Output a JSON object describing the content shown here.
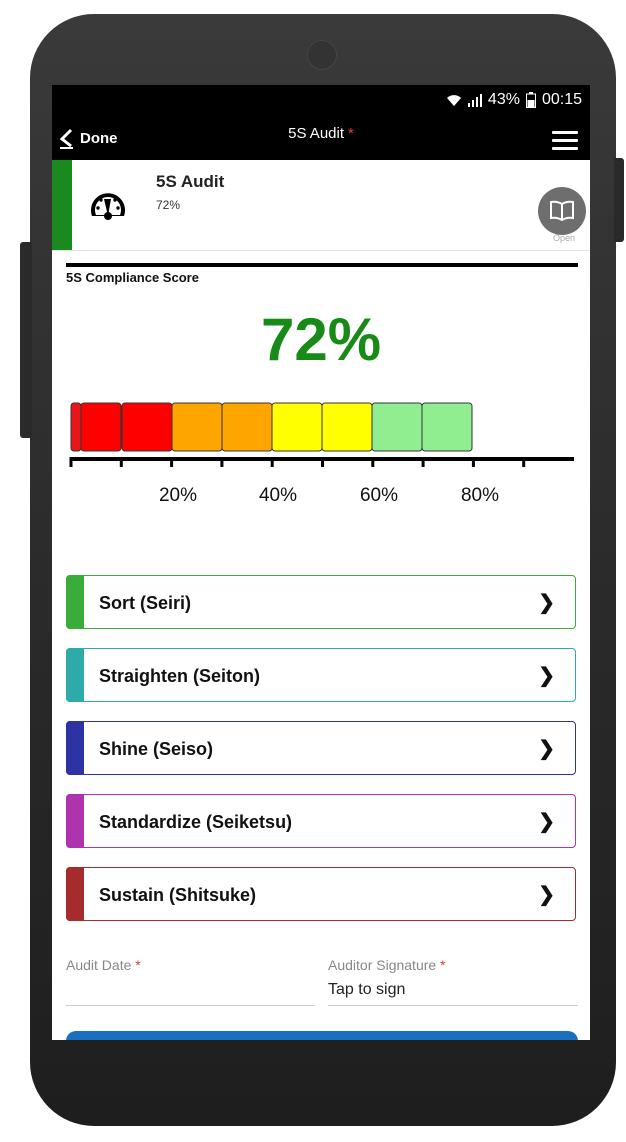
{
  "status": {
    "battery": "43%",
    "time": "00:15"
  },
  "appbar": {
    "done_label": "Done",
    "title": "5S Audit",
    "required_mark": "*"
  },
  "header": {
    "title": "5S Audit",
    "value": "72%",
    "open_label": "Open",
    "accent_color": "#1a8a1f"
  },
  "score": {
    "label": "5S Compliance Score",
    "value": "72%",
    "color": "#178a17"
  },
  "scale": {
    "segments": [
      {
        "color": "#e8161a"
      },
      {
        "color": "#ff0000"
      },
      {
        "color": "#ff0000"
      },
      {
        "color": "#ffa500"
      },
      {
        "color": "#ffa500"
      },
      {
        "color": "#ffff00"
      },
      {
        "color": "#ffff00"
      },
      {
        "color": "#90ee90"
      },
      {
        "color": "#90ee90"
      }
    ],
    "tick_labels": [
      "20%",
      "40%",
      "60%",
      "80%"
    ]
  },
  "sections": [
    {
      "label": "Sort (Seiri)",
      "color": "#3aac3a"
    },
    {
      "label": "Straighten (Seiton)",
      "color": "#2eaaa9"
    },
    {
      "label": "Shine (Seiso)",
      "color": "#2e33a3"
    },
    {
      "label": "Standardize (Seiketsu)",
      "color": "#ae34ae"
    },
    {
      "label": "Sustain (Shitsuke)",
      "color": "#a62b2b"
    }
  ],
  "fields": {
    "audit_date": {
      "label": "Audit Date",
      "required": "*",
      "value": ""
    },
    "auditor_signature": {
      "label": "Auditor Signature",
      "required": "*",
      "value": "Tap to sign"
    }
  }
}
